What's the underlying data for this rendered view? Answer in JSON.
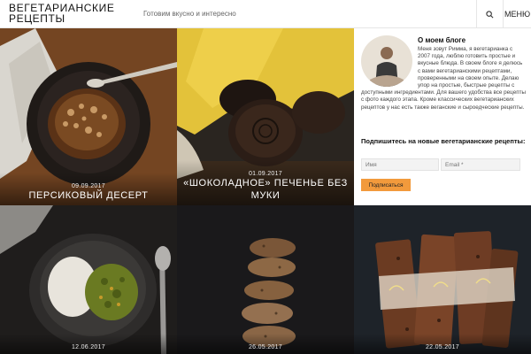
{
  "header": {
    "logo": "ВЕГЕТАРИАНСКИЕ РЕЦЕПТЫ",
    "tagline": "Готовим вкусно и интересно",
    "menu_label": "МЕНЮ"
  },
  "posts": [
    {
      "date": "09.09.2017",
      "title": "ПЕРСИКОВЫЙ ДЕСЕРТ"
    },
    {
      "date": "01.09.2017",
      "title": "«ШОКОЛАДНОЕ» ПЕЧЕНЬЕ БЕЗ МУКИ"
    },
    {
      "date": "12.06.2017",
      "title": ""
    },
    {
      "date": "26.05.2017",
      "title": ""
    },
    {
      "date": "22.05.2017",
      "title": ""
    }
  ],
  "sidebar": {
    "about_title": "О моем блоге",
    "about_text": "Меня зовут Римма, я вегетарианка с 2007 года, люблю готовить простые и вкусные блюда. В своем блоге я делюсь с вами вегетарианскими рецептами, проверенными на своем опыте. Делаю упор на простые, быстрые рецепты с доступными ингредиентами. Для вашего удобства все рецепты с фото каждого этапа. Кроме классических вегетарианских рецептов у нас есть также веганские и сыроедческие рецепты.",
    "subscribe_title": "Подпишитесь на новые вегетарианские рецепты:",
    "name_placeholder": "Имя",
    "email_placeholder": "Email *",
    "subscribe_button": "Подписаться"
  },
  "colors": {
    "accent": "#f29a3c",
    "header_bg": "#ffffff"
  },
  "icons": {
    "search": "search-icon"
  }
}
